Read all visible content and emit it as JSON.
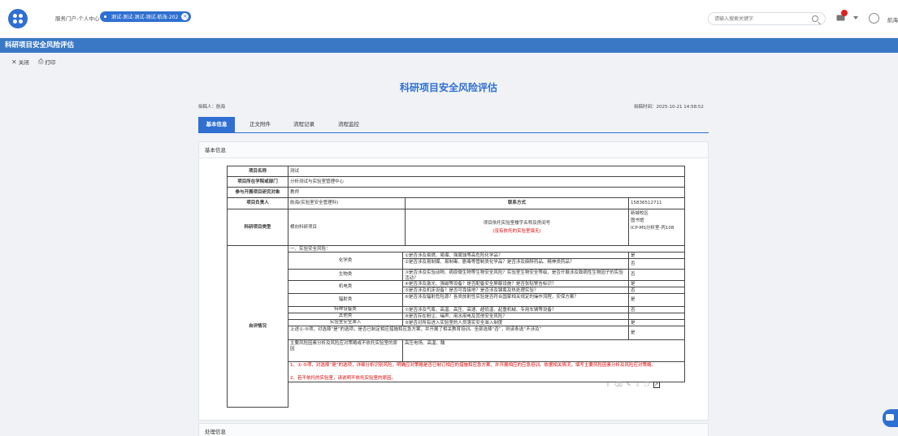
{
  "header": {
    "nav_link": "服务门户-个人中心",
    "active_tab": "测试-测试-测试-测试-航海-202",
    "search_placeholder": "请输入搜索关键字",
    "user": "航海"
  },
  "title_bar": "科研项目安全风险评估",
  "toolbar": {
    "close_label": "关闭",
    "print_label": "打印"
  },
  "page": {
    "title": "科研项目安全风险评估",
    "drafter": "拟稿人：航海",
    "draft_time": "拟稿时间：2025-10-21 14:58:52"
  },
  "tabs": [
    "基本信息",
    "正文附件",
    "流程记录",
    "流程监控"
  ],
  "section_basic": "基本信息",
  "section_process": "处理信息",
  "form": {
    "project_name_label": "项目名称",
    "project_name": "测试",
    "dept_label": "项目所在学院或部门",
    "dept": "分析测试与实验室管理中心",
    "participants_label": "参与开展项目研究对象",
    "participants": "教师",
    "leader_label": "项目负责人",
    "leader": "航海(实验室安全管理科)",
    "contact_label": "联系方式",
    "contact": "15836512711",
    "type_label": "科研项目类型",
    "type": "横向科研项目",
    "lab_label": "项目依托实验室楼宇名称及房间号",
    "lab_note": "(没有依托的实验室填无)",
    "lab_value": "新城校区\n图书馆\nICP-MS分析室-丙108",
    "self_eval_label": "自评情况",
    "risk_intro": "一、实验安全风险：",
    "risks": [
      {
        "cat": "化学类",
        "q": "①是否涉及易燃、易爆、强腐蚀等高危险化学品？",
        "a": "是"
      },
      {
        "cat": "",
        "q": "②是否涉及易制爆、易制毒、剧毒等管制类化学品？是否涉及麻醉药品、精神类药品？",
        "a": "否"
      },
      {
        "cat": "生物类",
        "q": "③是否涉及实验动物、病原微生物等生物安全风险？实验室生物安全等级，是否开展涉及致病性生物因子的实验活动？",
        "a": "否"
      },
      {
        "cat": "机电类",
        "q": "④是否涉及激光、强磁等设备？是否配备安全屏蔽设施？是否张贴警告标识？",
        "a": "是"
      },
      {
        "cat": "",
        "q": "⑤是否涉及机床设备？是否可靠接地？是否涉及钢瓶及热处理实验？",
        "a": "否"
      },
      {
        "cat": "辐射类",
        "q": "⑥是否涉及辐射危险源？各类放射性实验是否符合国家相关规定的操作流程，安保方案？",
        "a": "是"
      },
      {
        "cat": "特种设备类",
        "q": "⑦是否涉及气瓶、高温、高压、高速、超低温、起重机械、专用车辆等设备？",
        "a": "否"
      },
      {
        "cat": "其他类",
        "q": "⑧是否存在粉尘、噪声、用水用电及其他安全风险？",
        "a": ""
      },
      {
        "cat": "实验室安全准入",
        "q": "⑨是否对所有进入实验室的人员落实安全准入制度",
        "a": "是"
      }
    ],
    "summary_q": "上述①-⑨项，对选择“是”的选项，是否已制定相应措施和应急方案，并开展了相关教育培训。全部选择“否”，则该条选“不涉及”",
    "summary_a": "是",
    "main_risk_label": "主要风险因素分析及风险应对策略或不依托实验室的原因",
    "main_risk_value": "高压电场、高温、酸",
    "note1": "1、①-⑨项，对选择“是”的选项，详细分析识别风险，明确应对策略是否已制订相应的措施和应急方案，并开展相应的应急培训。依据相关情况，填写主要风险因素分析及风险应对策略。",
    "note2": "2、若不依托的实验室，请说明不依托实验室的原因。"
  }
}
